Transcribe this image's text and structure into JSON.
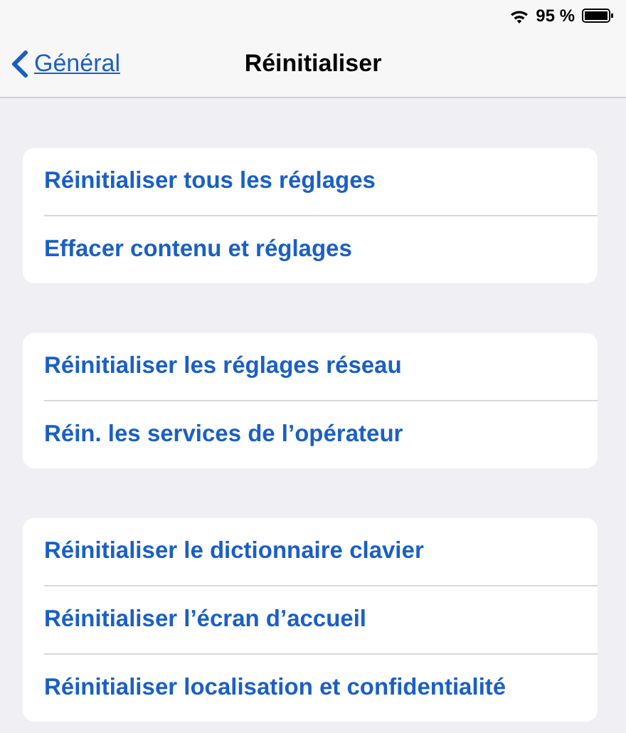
{
  "status_bar": {
    "battery_text": "95 %"
  },
  "nav_bar": {
    "back_label": "Général",
    "title": "Réinitialiser"
  },
  "groups": [
    {
      "items": [
        "Réinitialiser tous les réglages",
        "Effacer contenu et réglages"
      ]
    },
    {
      "items": [
        "Réinitialiser les réglages réseau",
        "Réin. les services de l’opérateur"
      ]
    },
    {
      "items": [
        "Réinitialiser le dictionnaire clavier",
        "Réinitialiser l’écran d’accueil",
        "Réinitialiser localisation et confidentialité"
      ]
    }
  ]
}
